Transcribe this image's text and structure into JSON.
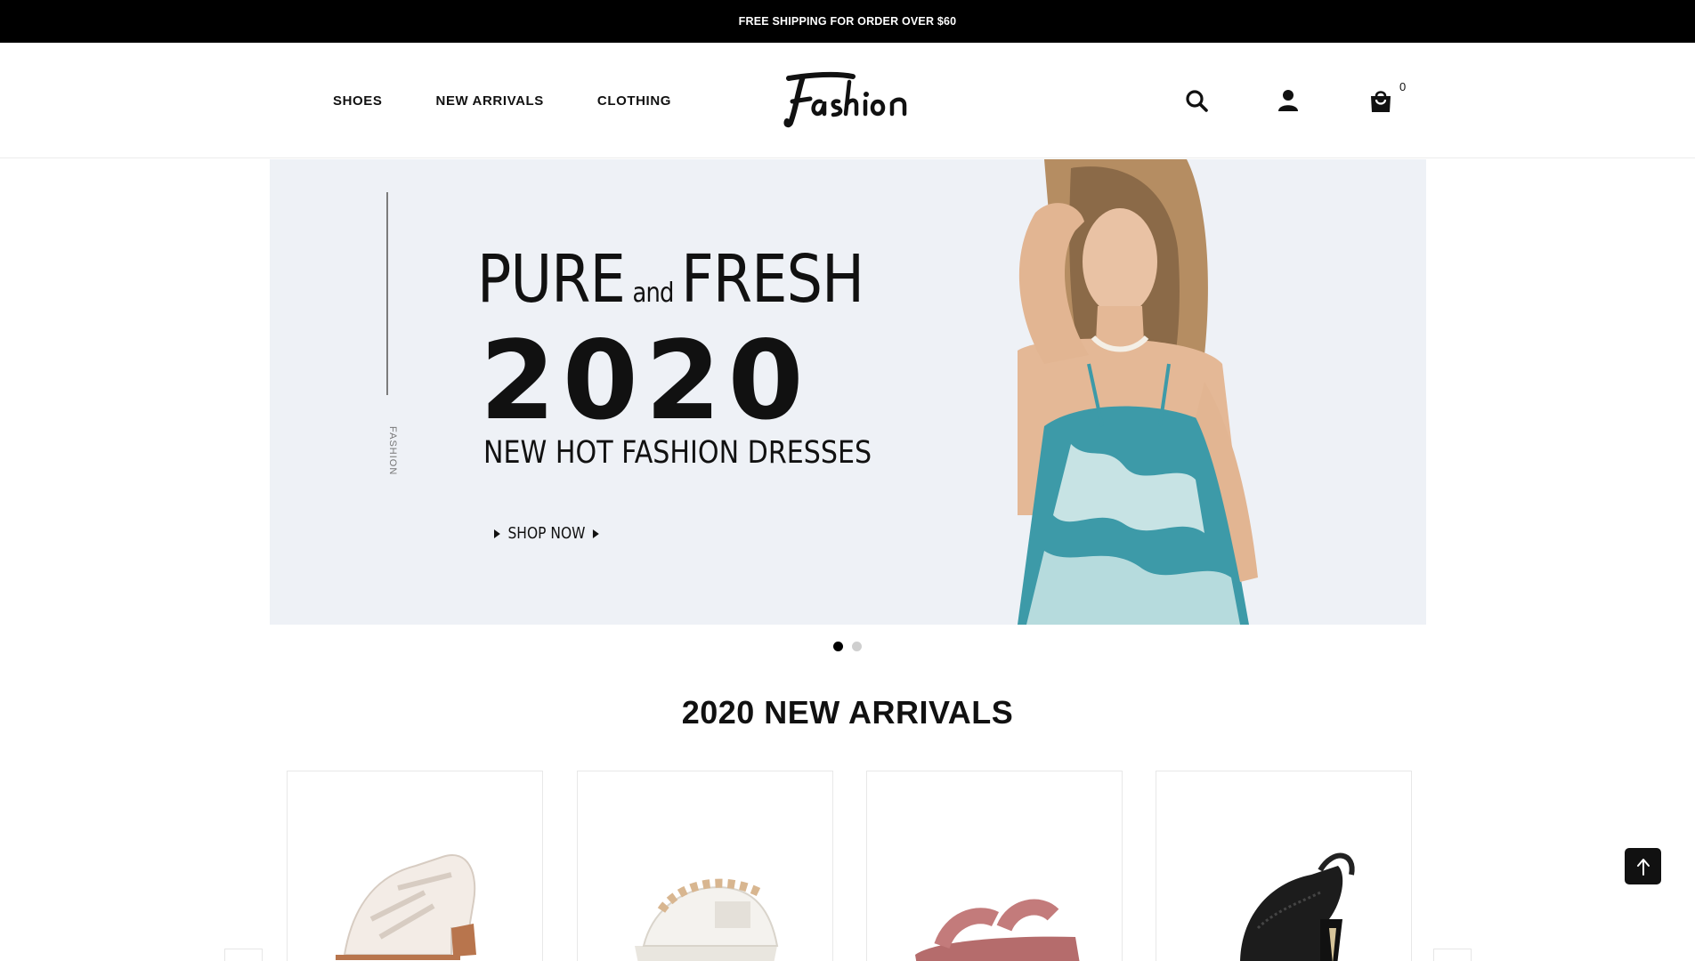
{
  "announcement": {
    "text": "FREE SHIPPING FOR ORDER OVER $60"
  },
  "nav": {
    "items": [
      {
        "label": "SHOES"
      },
      {
        "label": "NEW ARRIVALS"
      },
      {
        "label": "CLOTHING"
      }
    ]
  },
  "brand": {
    "logo_text": "Fashion"
  },
  "header_icons": {
    "search": "search-icon",
    "account": "user-icon",
    "cart": "shopping-bag-icon",
    "cart_count": "0"
  },
  "hero": {
    "vertical_text": "FASHION",
    "line1_a": "PURE",
    "line1_b": "and",
    "line1_c": "FRESH",
    "year": "2020",
    "line3": "NEW HOT FASHION DRESSES",
    "cta": "SHOP NOW",
    "background_color": "#eef1f6"
  },
  "slider": {
    "total": 2,
    "active": 1
  },
  "section": {
    "title": "2020 NEW ARRIVALS"
  },
  "products": [
    {
      "image": "white-block-heel-sandal"
    },
    {
      "image": "white-jeweled-platform-sandal"
    },
    {
      "image": "pink-strap-flat-sandal"
    },
    {
      "image": "black-mesh-heeled-sandal"
    }
  ],
  "controls": {
    "back_to_top": "arrow-up-icon"
  },
  "colors": {
    "announcement_bg": "#000000",
    "text": "#111111",
    "accent": "#000000"
  }
}
